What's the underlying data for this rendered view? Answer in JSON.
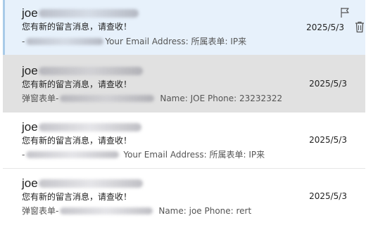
{
  "messages": [
    {
      "from_prefix": "joe",
      "subject": "您有新的留言消息，请查收！",
      "preview_prefix": "-",
      "preview_suffix": "Your Email Address:   所属表单:   IP来",
      "date": "2025/5/3",
      "state": "selected",
      "icons": [
        "flag-icon",
        "trash-icon"
      ]
    },
    {
      "from_prefix": "joe",
      "subject": "您有新的留言消息，请查收！",
      "preview_prefix": "弹窗表单-",
      "preview_suffix": "Name: JOE  Phone: 23232322",
      "date": "2025/5/3",
      "state": "hovered"
    },
    {
      "from_prefix": "joe",
      "subject": "您有新的留言消息，请查收！",
      "preview_prefix": "-",
      "preview_suffix": "Your Email Address:   所属表单:   IP来",
      "date": "2025/5/3",
      "state": "normal"
    },
    {
      "from_prefix": "joe",
      "subject": "您有新的留言消息，请查收！",
      "preview_prefix": "弹窗表单-",
      "preview_suffix": "Name: joe  Phone: rert",
      "date": "2025/5/3",
      "state": "normal"
    }
  ]
}
